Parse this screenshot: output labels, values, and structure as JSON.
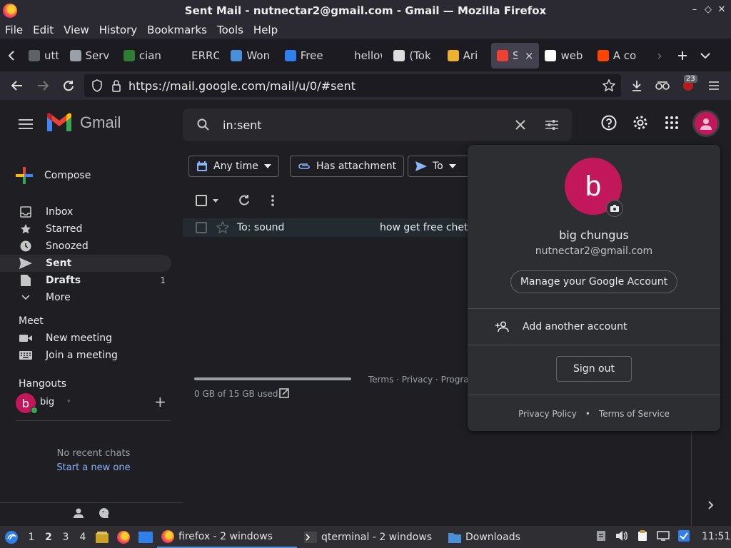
{
  "window": {
    "title": "Sent Mail - nutnectar2@gmail.com - Gmail — Mozilla Firefox",
    "controls": [
      "–",
      "◇",
      "✕"
    ]
  },
  "menu": [
    "File",
    "Edit",
    "View",
    "History",
    "Bookmarks",
    "Tools",
    "Help"
  ],
  "tabs": [
    {
      "title": "utte",
      "icon": "page-icon",
      "color": "#5f6368"
    },
    {
      "title": "Serv",
      "icon": "info-icon",
      "color": "#9aa0a6"
    },
    {
      "title": "cian",
      "icon": "leaf-icon",
      "color": "#2e7d32"
    },
    {
      "title": "ERROR",
      "icon": "blank-icon",
      "color": "#1c1b22"
    },
    {
      "title": "Won",
      "icon": "wave-icon",
      "color": "#4a90d9"
    },
    {
      "title": "Free",
      "icon": "in-icon",
      "color": "#2f80ed"
    },
    {
      "title": "hellowo",
      "icon": "blank-icon",
      "color": "#1c1b22"
    },
    {
      "title": "(Tok",
      "icon": "qr-icon",
      "color": "#dddddd"
    },
    {
      "title": "Ari",
      "icon": "slack-icon",
      "color": "#ecb22e"
    },
    {
      "title": "Se",
      "icon": "gmail-icon",
      "color": "#ea4335"
    },
    {
      "title": "web",
      "icon": "github-icon",
      "color": "#ffffff"
    },
    {
      "title": "A co",
      "icon": "reddit-icon",
      "color": "#ff4500"
    }
  ],
  "url": "https://mail.google.com/mail/u/0/#sent",
  "extension_badge": "23",
  "gmail": {
    "brand": "Gmail",
    "search_query": "in:sent",
    "compose_label": "Compose",
    "nav": [
      {
        "label": "Inbox",
        "icon": "inbox-icon",
        "count": ""
      },
      {
        "label": "Starred",
        "icon": "star-icon",
        "count": ""
      },
      {
        "label": "Snoozed",
        "icon": "clock-icon",
        "count": ""
      },
      {
        "label": "Sent",
        "icon": "send-icon",
        "count": "",
        "active": true
      },
      {
        "label": "Drafts",
        "icon": "draft-icon",
        "count": "1"
      },
      {
        "label": "More",
        "icon": "chevron-down-icon",
        "count": ""
      }
    ],
    "meet": {
      "heading": "Meet",
      "new_meeting": "New meeting",
      "join": "Join a meeting"
    },
    "hangouts": {
      "heading": "Hangouts",
      "user": "big",
      "avatar_letter": "b",
      "no_chats": "No recent chats",
      "start_new": "Start a new one"
    },
    "chips": [
      "Any time",
      "Has attachment",
      "To"
    ],
    "rows": [
      {
        "to": "To: sound",
        "subject": "how get free chetal"
      }
    ],
    "storage": "0 GB of 15 GB used",
    "footer_links": "Terms · Privacy · Program"
  },
  "account": {
    "avatar_letter": "b",
    "name": "big chungus",
    "email": "nutnectar2@gmail.com",
    "manage": "Manage your Google Account",
    "add_account": "Add another account",
    "sign_out": "Sign out",
    "privacy": "Privacy Policy",
    "dot": "•",
    "terms": "Terms of Service"
  },
  "taskbar": {
    "workspaces": [
      "1",
      "2",
      "3",
      "4"
    ],
    "current_workspace": "2",
    "firefox": "firefox - 2 windows",
    "terminal": "qterminal - 2 windows",
    "downloads": "Downloads",
    "clock": "11:51"
  },
  "colors": {
    "accent": "#c2185b",
    "gmail_red": "#ea4335",
    "active_underline": "#4a90d9"
  }
}
